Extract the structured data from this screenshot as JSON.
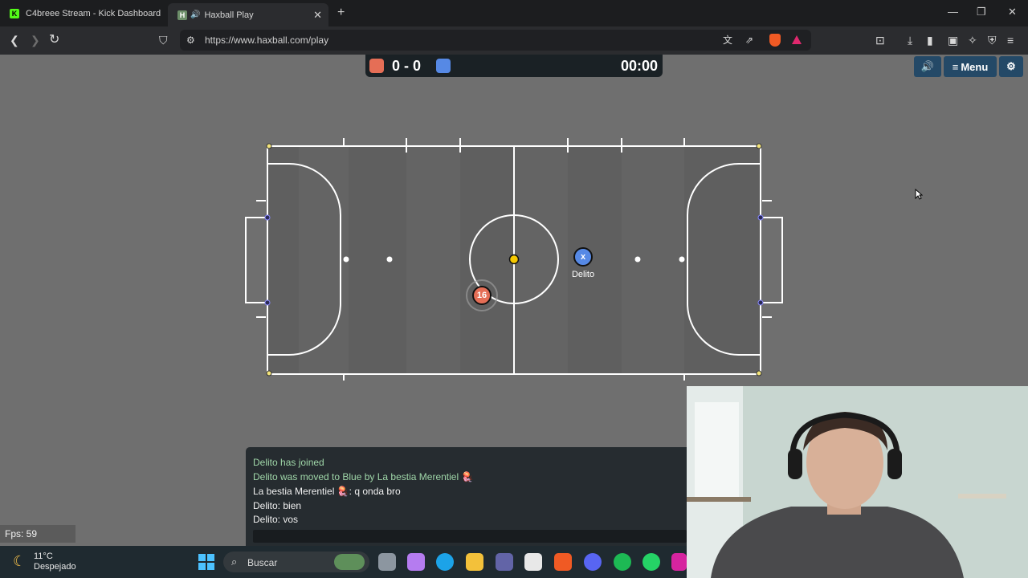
{
  "tabs": [
    {
      "title": "C4breee Stream - Kick Dashboard",
      "icon": "kick-icon",
      "active": false
    },
    {
      "title": "Haxball Play",
      "icon": "haxball-icon",
      "active": true
    }
  ],
  "address": {
    "url": "https://www.haxball.com/play"
  },
  "game": {
    "score": "0 - 0",
    "time": "00:00",
    "menu_label": "Menu",
    "red_color": "#e56e56",
    "blue_color": "#5689e5",
    "players": [
      {
        "team": "red",
        "avatar": "16",
        "name": ""
      },
      {
        "team": "blue",
        "avatar": "x",
        "name": "Delito"
      }
    ],
    "fps": "Fps: 59"
  },
  "chat": {
    "messages": [
      {
        "text": "Delito has joined",
        "kind": "notice"
      },
      {
        "text": "Delito was moved to Blue by La bestia Merentiel 🪼",
        "kind": "notice"
      },
      {
        "text": "La bestia Merentiel 🪼: q onda bro",
        "kind": "chat"
      },
      {
        "text": "Delito: bien",
        "kind": "chat"
      },
      {
        "text": "Delito: vos",
        "kind": "chat"
      }
    ]
  },
  "taskbar": {
    "temperature": "11°C",
    "condition": "Despejado",
    "search_label": "Buscar"
  }
}
